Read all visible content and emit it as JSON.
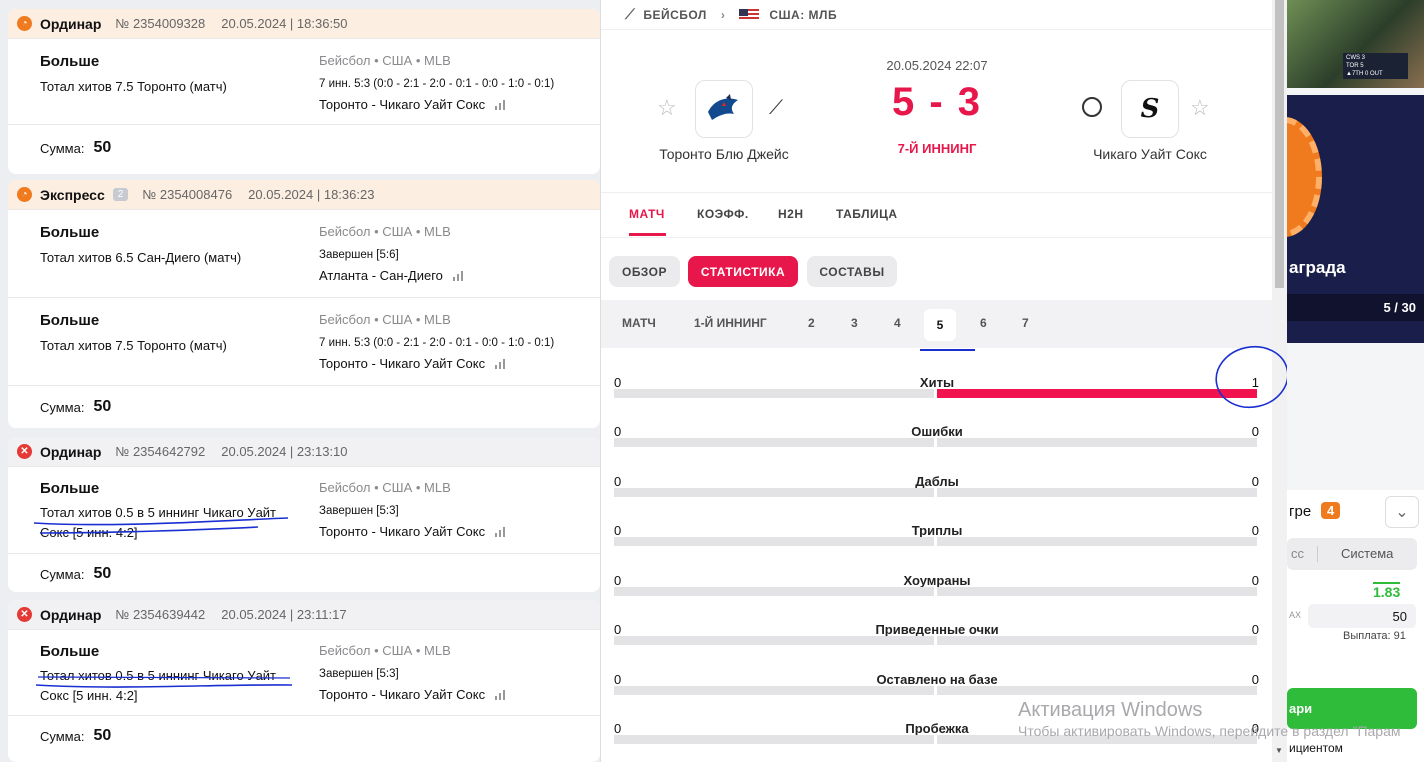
{
  "bets": [
    {
      "status": "pending",
      "type": "Ординар",
      "count": "",
      "number": "№ 2354009328",
      "date": "20.05.2024 | 18:36:50",
      "legs": [
        {
          "outcome": "Больше",
          "market": "Тотал хитов 7.5 Торонто (матч)",
          "sport": "Бейсбол • США • MLB",
          "score": "7 инн. 5:3 (0:0 - 2:1 - 2:0 - 0:1 - 0:0 - 1:0 - 0:1)",
          "teams": "Торонто - Чикаго Уайт Сокс"
        }
      ],
      "sum_label": "Сумма:",
      "sum": "50"
    },
    {
      "status": "pending",
      "type": "Экспресс",
      "count": "2",
      "number": "№ 2354008476",
      "date": "20.05.2024 | 18:36:23",
      "legs": [
        {
          "outcome": "Больше",
          "market": "Тотал хитов 6.5 Сан-Диего (матч)",
          "sport": "Бейсбол • США • MLB",
          "score": "Завершен [5:6]",
          "teams": "Атланта - Сан-Диего"
        },
        {
          "outcome": "Больше",
          "market": "Тотал хитов 7.5 Торонто (матч)",
          "sport": "Бейсбол • США • MLB",
          "score": "7 инн. 5:3 (0:0 - 2:1 - 2:0 - 0:1 - 0:0 - 1:0 - 0:1)",
          "teams": "Торонто - Чикаго Уайт Сокс"
        }
      ],
      "sum_label": "Сумма:",
      "sum": "50"
    },
    {
      "status": "lost",
      "type": "Ординар",
      "count": "",
      "number": "№ 2354642792",
      "date": "20.05.2024 | 23:13:10",
      "legs": [
        {
          "outcome": "Больше",
          "market": "Тотал хитов 0.5 в 5 иннинг Чикаго Уайт Сокс [5 инн. 4:2]",
          "sport": "Бейсбол • США • MLB",
          "score": "Завершен [5:3]",
          "teams": "Торонто - Чикаго Уайт Сокс"
        }
      ],
      "sum_label": "Сумма:",
      "sum": "50"
    },
    {
      "status": "lost",
      "type": "Ординар",
      "count": "",
      "number": "№ 2354639442",
      "date": "20.05.2024 | 23:11:17",
      "legs": [
        {
          "outcome": "Больше",
          "market": "Тотал хитов 0.5 в 5 иннинг Чикаго Уайт Сокс [5 инн. 4:2]",
          "sport": "Бейсбол • США • MLB",
          "score": "Завершен [5:3]",
          "teams": "Торонто - Чикаго Уайт Сокс"
        }
      ],
      "sum_label": "Сумма:",
      "sum": "50"
    }
  ],
  "match": {
    "breadcrumb": {
      "sport": "БЕЙСБОЛ",
      "league": "США: МЛБ"
    },
    "datetime": "20.05.2024 22:07",
    "score": "5 - 3",
    "period": "7-Й ИННИНГ",
    "home": "Торонто Блю Джейс",
    "away": "Чикаго Уайт Сокс",
    "tabs": [
      "МАТЧ",
      "КОЭФФ.",
      "H2H",
      "ТАБЛИЦА"
    ],
    "subtabs": [
      "ОБЗОР",
      "СТАТИСТИКА",
      "СОСТАВЫ"
    ],
    "innings": [
      "МАТЧ",
      "1-Й ИННИНГ",
      "2",
      "3",
      "4",
      "5",
      "6",
      "7"
    ],
    "active_inning": "5",
    "stats": [
      {
        "name": "Хиты",
        "home": "0",
        "away": "1"
      },
      {
        "name": "Ошибки",
        "home": "0",
        "away": "0"
      },
      {
        "name": "Даблы",
        "home": "0",
        "away": "0"
      },
      {
        "name": "Триплы",
        "home": "0",
        "away": "0"
      },
      {
        "name": "Хоумраны",
        "home": "0",
        "away": "0"
      },
      {
        "name": "Приведенные очки",
        "home": "0",
        "away": "0"
      },
      {
        "name": "Оставлено на базе",
        "home": "0",
        "away": "0"
      },
      {
        "name": "Пробежка",
        "home": "0",
        "away": "0"
      }
    ]
  },
  "side": {
    "scoreboard": [
      "CWS",
      "3",
      "TOR",
      "5",
      "▲7TH",
      "0 OUT"
    ],
    "promo": "аграда",
    "promo_count": "5 / 30",
    "slip_label": "гре",
    "slip_count": "4",
    "tab_a": "сс",
    "tab_b": "Система",
    "odds": "1.83",
    "max": "AX",
    "stake": "50",
    "payout": "Выплата: 91",
    "button": "ари",
    "footer": "ициентом"
  },
  "watermark": {
    "title": "Активация Windows",
    "text": "Чтобы активировать Windows, перейдите в раздел \"Парам"
  },
  "colors": {
    "accent": "#e8174b",
    "pending": "#f07a1e",
    "lost": "#e53935",
    "green": "#2ebc3a"
  }
}
